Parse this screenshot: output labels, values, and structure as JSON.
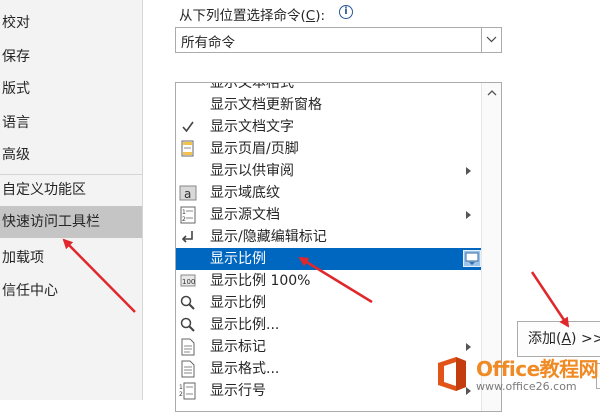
{
  "nav": {
    "items": [
      {
        "label": "校对"
      },
      {
        "label": "保存"
      },
      {
        "label": "版式"
      },
      {
        "label": "语言"
      },
      {
        "label": "高级"
      },
      {
        "label": "自定义功能区"
      },
      {
        "label": "快速访问工具栏",
        "selected": true
      },
      {
        "label": "加载项"
      },
      {
        "label": "信任中心"
      }
    ]
  },
  "commands": {
    "source_label_prefix": "从下列位置选择命令(",
    "source_label_key": "C",
    "source_label_suffix": "):",
    "info_icon": "i",
    "source_value": "所有命令",
    "items": [
      {
        "label": "显示文本格式",
        "icon": "none"
      },
      {
        "label": "显示文档更新窗格",
        "icon": "none"
      },
      {
        "label": "显示文档文字",
        "icon": "checkmark-icon"
      },
      {
        "label": "显示页眉/页脚",
        "icon": "header-footer-icon"
      },
      {
        "label": "显示以供审阅",
        "icon": "none",
        "submenu": true
      },
      {
        "label": "显示域底纹",
        "icon": "field-shading-icon"
      },
      {
        "label": "显示源文档",
        "icon": "source-doc-icon",
        "submenu": true
      },
      {
        "label": "显示/隐藏编辑标记",
        "icon": "formatting-marks-icon"
      },
      {
        "label": "显示比例",
        "icon": "none",
        "selected": true,
        "add_control": true
      },
      {
        "label": "显示比例 100%",
        "icon": "zoom-100-icon"
      },
      {
        "label": "显示比例",
        "icon": "zoom-icon"
      },
      {
        "label": "显示比例...",
        "icon": "zoom-icon"
      },
      {
        "label": "显示标记",
        "icon": "markup-icon",
        "submenu": true
      },
      {
        "label": "显示格式...",
        "icon": "formatting-icon"
      },
      {
        "label": "显示行号",
        "icon": "line-numbers-icon",
        "submenu": true
      }
    ]
  },
  "add_button": {
    "label_prefix": "添加(",
    "label_key": "A",
    "label_suffix": ") >>"
  },
  "watermark": {
    "main": "Office教程网",
    "url": "www.office26.com"
  },
  "colors": {
    "selection": "#0067c0",
    "annotation_arrow": "#e0272b",
    "watermark_orange": "#f08a24"
  }
}
